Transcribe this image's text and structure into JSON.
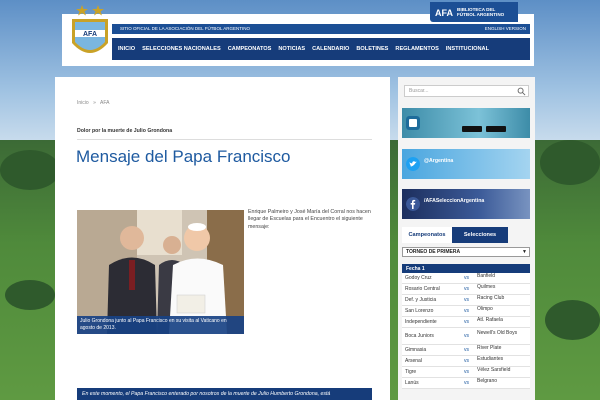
{
  "header": {
    "institution": "SITIO OFICIAL DE LA ASOCIACIÓN DEL FÚTBOL ARGENTINO",
    "english": "ENGLISH VERSION",
    "nav": [
      "INICIO",
      "SELECCIONES NACIONALES",
      "CAMPEONATOS",
      "NOTICIAS",
      "CALENDARIO",
      "BOLETINES",
      "REGLAMENTOS",
      "INSTITUCIONAL"
    ],
    "biblioteca_line1": "BIBLIOTECA DEL",
    "biblioteca_line2": "FÚTBOL ARGENTINO",
    "crest_text": "AFA",
    "mini_logo_text": "AFA"
  },
  "breadcrumb": [
    "Inicio",
    "»",
    "AFA"
  ],
  "article": {
    "subhead": "Dolor por la muerte de Julio Grondona",
    "title": "Mensaje del Papa Francisco",
    "caption": "Julio Grondona junto al Papa Francisco en su visita al Vaticano en agosto de 2013.",
    "body": "Enrique Palmeiro y José María del Corral nos hacen llegar de Escuelas para el Encuentro el siguiente mensaje:",
    "quote": "En este momento, el Papa Francisco enterado por nosotros de la muerte de Julio Humberto Grondona, está"
  },
  "sidebar": {
    "search_placeholder": "Buscar...",
    "banners": [
      {
        "label": "",
        "icon": "app-icon"
      },
      {
        "label": "@Argentina",
        "icon": "twitter-icon"
      },
      {
        "label": "/AFASeleccionArgentina",
        "icon": "facebook-icon"
      }
    ],
    "tabs": [
      "Campeonatos",
      "Selecciones"
    ],
    "select": "TORNEO DE PRIMERA",
    "fecha": "Fecha 1",
    "fixtures": [
      {
        "home": "Godoy Cruz",
        "vs": "vs",
        "away": "Banfield"
      },
      {
        "home": "Rosario Central",
        "vs": "vs",
        "away": "Quilmes"
      },
      {
        "home": "Def. y Justicia",
        "vs": "vs",
        "away": "Racing Club"
      },
      {
        "home": "San Lorenzo",
        "vs": "vs",
        "away": "Olimpo"
      },
      {
        "home": "Independiente",
        "vs": "vs",
        "away": "Atl. Rafaela"
      },
      {
        "home": "Boca Juniors",
        "vs": "vs",
        "away": "Newell's Old Boys"
      },
      {
        "home": "Gimnasia",
        "vs": "vs",
        "away": "River Plate"
      },
      {
        "home": "Arsenal",
        "vs": "vs",
        "away": "Estudiantes"
      },
      {
        "home": "Tigre",
        "vs": "vs",
        "away": "Vélez Sarsfield"
      },
      {
        "home": "Lanús",
        "vs": "vs",
        "away": "Belgrano"
      }
    ]
  },
  "colors": {
    "primary": "#163c7a",
    "accent": "#1e5aa0",
    "title": "#1e5aa0"
  }
}
